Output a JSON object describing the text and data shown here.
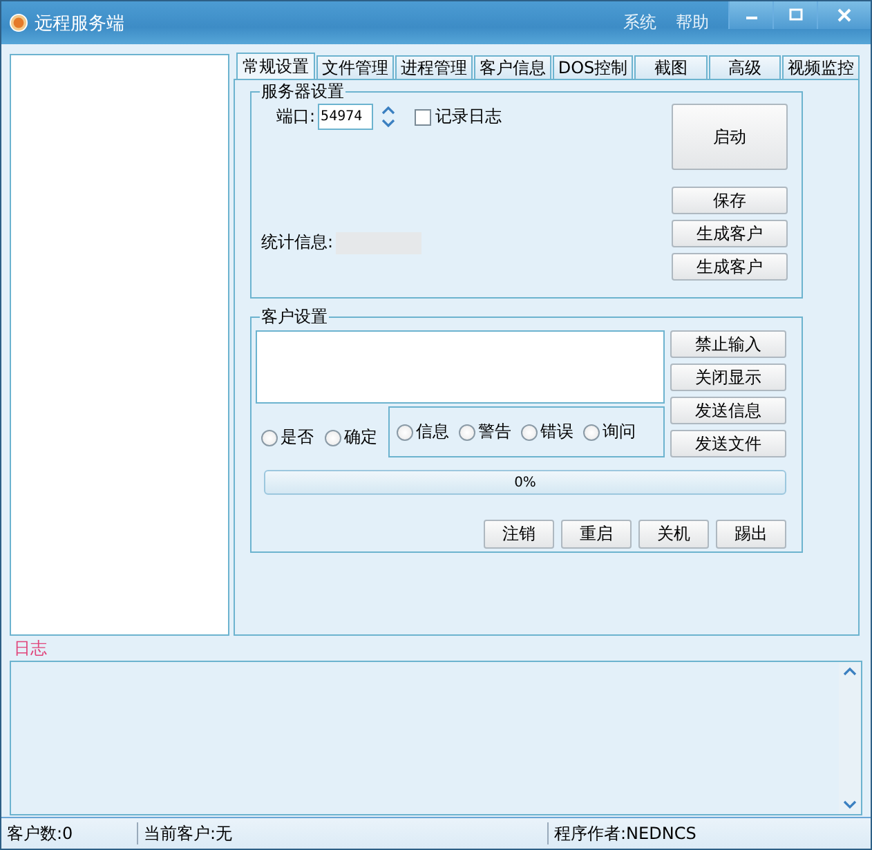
{
  "window": {
    "title": "远程服务端",
    "menu": [
      "系统",
      "帮助"
    ]
  },
  "tabs": [
    {
      "label": "常规设置",
      "selected": true
    },
    {
      "label": "文件管理",
      "selected": false
    },
    {
      "label": "进程管理",
      "selected": false
    },
    {
      "label": "客户信息",
      "selected": false
    },
    {
      "label": "DOS控制",
      "selected": false
    },
    {
      "label": "截图",
      "selected": false
    },
    {
      "label": "高级",
      "selected": false
    },
    {
      "label": "视频监控",
      "selected": false
    }
  ],
  "server_settings": {
    "title": "服务器设置",
    "port_label": "端口:",
    "port": "54974",
    "log_checkbox": {
      "label": "记录日志",
      "checked": false
    },
    "stats_label": "统计信息:",
    "start_button": "启动",
    "buttons": [
      "保存",
      "生成客户",
      "生成客户"
    ]
  },
  "client_settings": {
    "title": "客户设置",
    "button_radios": [
      {
        "label": "是否",
        "selected": false
      },
      {
        "label": "确定",
        "selected": false
      }
    ],
    "icon_radios": [
      {
        "label": "信息",
        "selected": false
      },
      {
        "label": "警告",
        "selected": false
      },
      {
        "label": "错误",
        "selected": false
      },
      {
        "label": "询问",
        "selected": false
      }
    ],
    "side_buttons": [
      "禁止输入",
      "关闭显示",
      "发送信息",
      "发送文件"
    ],
    "progress": {
      "level": 0,
      "reading": "0%"
    },
    "action_buttons": [
      "注销",
      "重启",
      "关机",
      "踢出"
    ]
  },
  "log": {
    "title": "日志"
  },
  "status_bar": [
    "客户数:0",
    "当前客户:无",
    "程序作者:NEDNCS"
  ]
}
